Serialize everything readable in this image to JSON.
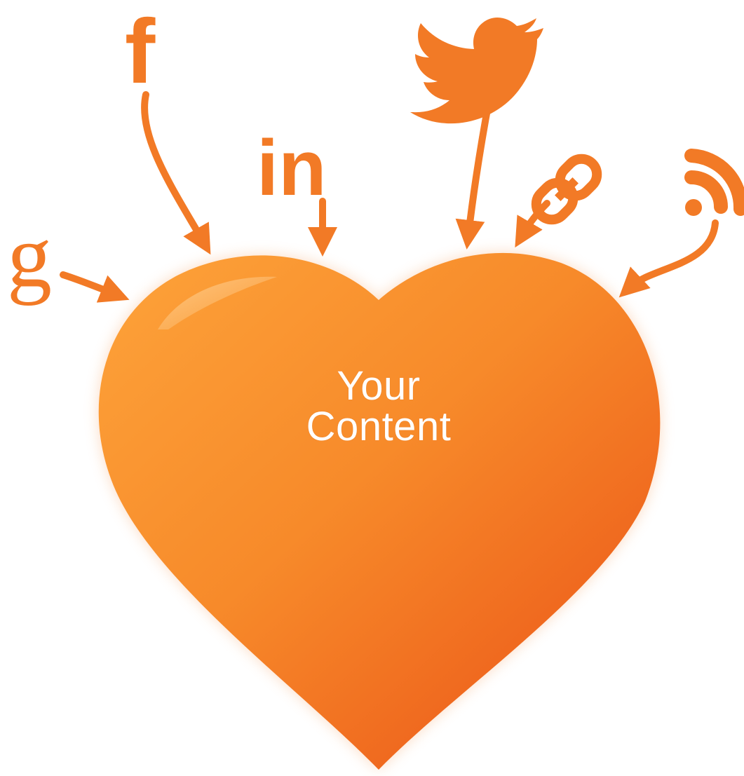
{
  "colors": {
    "accent": "#f27a26",
    "accent_light": "#fb9a32",
    "accent_dark": "#ef5c1b",
    "label": "#ffffff"
  },
  "icons": {
    "facebook": {
      "name": "facebook-icon",
      "glyph": "f"
    },
    "linkedin": {
      "name": "linkedin-icon",
      "glyph": "in"
    },
    "google": {
      "name": "google-icon",
      "glyph": "g"
    },
    "twitter": {
      "name": "twitter-bird-icon"
    },
    "link": {
      "name": "chain-link-icon"
    },
    "rss": {
      "name": "rss-feed-icon"
    }
  },
  "heart": {
    "line1": "Your",
    "line2": "Content"
  }
}
